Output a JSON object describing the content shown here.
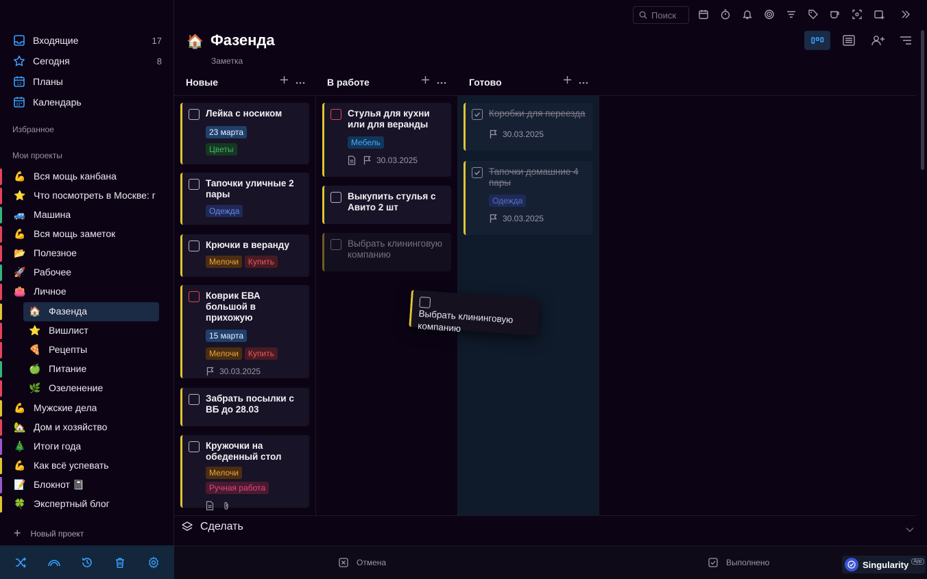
{
  "sidebar": {
    "nav": [
      {
        "label": "Входящие",
        "count": "17",
        "icon": "inbox-icon"
      },
      {
        "label": "Сегодня",
        "count": "8",
        "icon": "star-icon"
      },
      {
        "label": "Планы",
        "count": "",
        "icon": "calendar-12-icon"
      },
      {
        "label": "Календарь",
        "count": "",
        "icon": "calendar-icon"
      }
    ],
    "favorites_label": "Избранное",
    "projects_label": "Мои проекты",
    "projects": [
      {
        "emoji": "💪",
        "label": "Вся мощь канбана",
        "color": "#e5445c"
      },
      {
        "emoji": "⭐",
        "label": "Что посмотреть в Москве: г",
        "color": "#e5445c"
      },
      {
        "emoji": "🚙",
        "label": "Машина",
        "color": "#36b37e"
      },
      {
        "emoji": "💪",
        "label": "Вся мощь заметок",
        "color": "#e5445c"
      },
      {
        "emoji": "📂",
        "label": "Полезное",
        "color": "#e5445c"
      },
      {
        "emoji": "🚀",
        "label": "Рабочее",
        "color": "#36b37e"
      },
      {
        "emoji": "👛",
        "label": "Личное",
        "color": "#e5445c"
      },
      {
        "emoji": "🏠",
        "label": "Фазенда",
        "color": "#e0c431"
      },
      {
        "emoji": "⭐",
        "label": "Вишлист",
        "color": "#e5445c"
      },
      {
        "emoji": "🍕",
        "label": "Рецепты",
        "color": "#e5445c"
      },
      {
        "emoji": "🍏",
        "label": "Питание",
        "color": "#36b37e"
      },
      {
        "emoji": "🌿",
        "label": "Озеленение",
        "color": "#e5445c"
      },
      {
        "emoji": "💪",
        "label": "Мужские дела",
        "color": "#e0c431"
      },
      {
        "emoji": "🏡",
        "label": "Дом и хозяйство",
        "color": "#e5445c"
      },
      {
        "emoji": "🎄",
        "label": "Итоги года",
        "color": "#9b59d0"
      },
      {
        "emoji": "💪",
        "label": "Как всё успевать",
        "color": "#e0c431"
      },
      {
        "emoji": "📝",
        "label": "Блокнот 📓",
        "color": "#9b59d0"
      },
      {
        "emoji": "🍀",
        "label": "Экспертный блог",
        "color": "#e0c431"
      }
    ],
    "new_project": "Новый проект",
    "bottom_icons": [
      "shuffle-icon",
      "signal-icon",
      "history-icon",
      "trash-icon",
      "settings-icon"
    ]
  },
  "topbar": {
    "search_placeholder": "Поиск"
  },
  "header": {
    "emoji": "🏠",
    "title": "Фазенда",
    "subtitle": "Заметка"
  },
  "columns": [
    {
      "title": "Новые"
    },
    {
      "title": "В работе"
    },
    {
      "title": "Готово"
    }
  ],
  "cards": {
    "c1": {
      "title": "Лейка с носиком",
      "date_tag": "23 марта",
      "tag": "Цветы"
    },
    "c2": {
      "title": "Тапочки уличные 2 пары",
      "tag": "Одежда"
    },
    "c3": {
      "title": "Крючки в веранду",
      "tag1": "Мелочи",
      "tag2": "Купить"
    },
    "c4": {
      "title": "Коврик ЕВА большой в прихожую",
      "date_tag": "15 марта",
      "tag1": "Мелочи",
      "tag2": "Купить",
      "due": "30.03.2025"
    },
    "c5": {
      "title": "Забрать посылки с ВБ до 28.03"
    },
    "c6": {
      "title": "Кружочки на обеденный стол",
      "tag1": "Мелочи",
      "tag2": "Ручная работа"
    },
    "w1": {
      "title": "Стулья для кухни или для веранды",
      "tag": "Мебель",
      "due": "30.03.2025"
    },
    "w2": {
      "title": "Выкупить стулья с Авито 2 шт"
    },
    "w3": {
      "title": "Выбрать клининговую компанию"
    },
    "d1": {
      "title": "Коробки для переезда",
      "due": "30.03.2025"
    },
    "d2": {
      "title": "Тапочки домашние 4 пары",
      "tag": "Одежда",
      "due": "30.03.2025"
    },
    "drag": {
      "title": "Выбрать клининговую компанию"
    }
  },
  "section": {
    "title": "Сделать"
  },
  "drop_zones": {
    "cancel": "Отмена",
    "done": "Выполнено"
  },
  "brand": {
    "name": "Singularity",
    "badge": "App"
  }
}
